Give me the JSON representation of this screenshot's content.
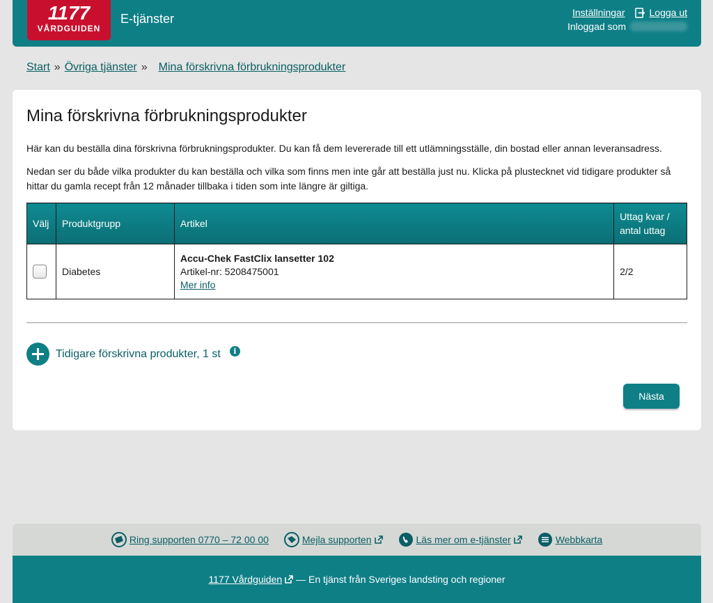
{
  "header": {
    "logo_number": "1177",
    "logo_text": "VÅRDGUIDEN",
    "service_name": "E-tjänster",
    "settings_link": "Inställningar",
    "logout_link": "Logga ut",
    "logged_in_label": "Inloggad som"
  },
  "breadcrumb": {
    "items": [
      "Start",
      "Övriga tjänster",
      "Mina förskrivna förbrukningsprodukter"
    ],
    "separator": "»"
  },
  "main": {
    "title": "Mina förskrivna förbrukningsprodukter",
    "intro1": "Här kan du beställa dina förskrivna förbrukningsprodukter. Du kan få dem levererade till ett utlämningsställe, din bostad eller annan leveransadress.",
    "intro2": "Nedan ser du både vilka produkter du kan beställa och vilka som finns men inte går att beställa just nu. Klicka på plustecknet vid tidigare produkter så hittar du gamla recept från 12 månader tillbaka i tiden som inte längre är giltiga.",
    "table": {
      "headers": [
        "Välj",
        "Produktgrupp",
        "Artikel",
        "Uttag kvar / antal uttag"
      ],
      "rows": [
        {
          "group": "Diabetes",
          "article_name": "Accu-Chek FastClix lansetter 102",
          "article_number": "Artikel-nr: 5208475001",
          "more_info": "Mer info",
          "withdrawals": "2/2",
          "selected": false
        }
      ]
    },
    "earlier_products": "Tidigare förskrivna produkter, 1 st",
    "info_icon": "i",
    "next_button": "Nästa"
  },
  "footer": {
    "links": [
      {
        "label": "Ring supporten 0770 – 72 00 00",
        "icon": "phone-icon"
      },
      {
        "label": "Mejla supporten",
        "icon": "mail-icon"
      },
      {
        "label": "Läs mer om e-tjänster",
        "icon": "info-phone-icon"
      },
      {
        "label": "Webbkarta",
        "icon": "sitemap-icon"
      }
    ],
    "bottom_link": "1177 Vårdguiden",
    "bottom_text": "— En tjänst från Sveriges landsting och regioner"
  },
  "colors": {
    "brand_teal": "#0f7f86",
    "logo_red": "#c8102e",
    "link": "#0a5e64",
    "background": "#e5e5e5"
  }
}
